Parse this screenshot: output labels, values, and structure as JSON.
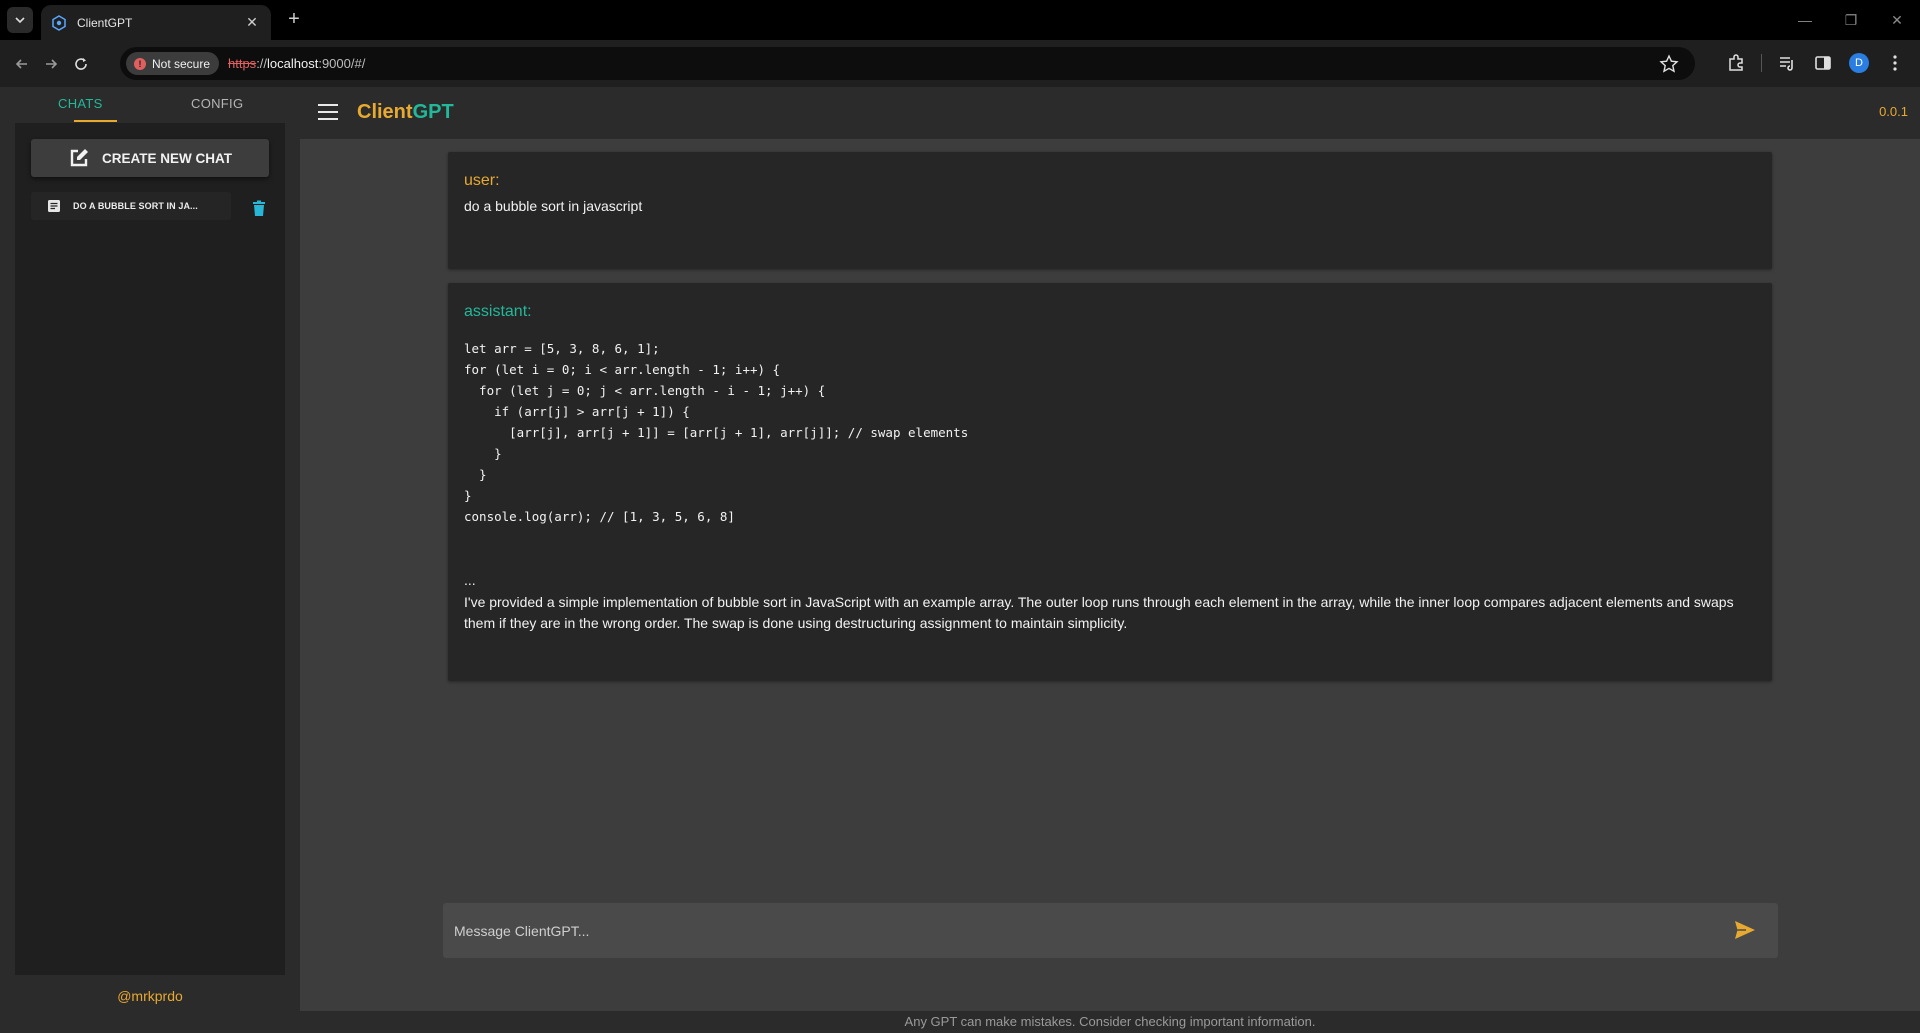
{
  "browser": {
    "tab_title": "ClientGPT",
    "security_label": "Not secure",
    "url_scheme": "https",
    "url_sep": "://",
    "url_host": "localhost",
    "url_rest": ":9000/#/",
    "profile_initial": "D"
  },
  "sidebar": {
    "tabs": [
      {
        "label": "CHATS",
        "active": true
      },
      {
        "label": "CONFIG",
        "active": false
      }
    ],
    "new_chat_label": "CREATE NEW CHAT",
    "chats": [
      {
        "label": "DO A BUBBLE SORT IN JA..."
      }
    ],
    "handle": "@mrkprdo"
  },
  "appbar": {
    "brand_part1": "Client",
    "brand_part2": "GPT",
    "version": "0.0.1"
  },
  "messages": {
    "user": {
      "role": "user:",
      "text": "do a bubble sort in javascript"
    },
    "assistant": {
      "role": "assistant:",
      "code": "let arr = [5, 3, 8, 6, 1];\nfor (let i = 0; i < arr.length - 1; i++) {\n  for (let j = 0; j < arr.length - i - 1; j++) {\n    if (arr[j] > arr[j + 1]) {\n      [arr[j], arr[j + 1]] = [arr[j + 1], arr[j]]; // swap elements\n    }\n  }\n}\nconsole.log(arr); // [1, 3, 5, 6, 8]",
      "ellipsis": "...",
      "explanation": "I've provided a simple implementation of bubble sort in JavaScript with an example array. The outer loop runs through each element in the array, while the inner loop compares adjacent elements and swaps them if they are in the wrong order. The swap is done using destructuring assignment to maintain simplicity."
    }
  },
  "composer": {
    "placeholder": "Message ClientGPT..."
  },
  "footer": {
    "disclaimer": "Any GPT can make mistakes. Consider checking important information."
  },
  "colors": {
    "accent_orange": "#e8a930",
    "accent_teal": "#22b89a",
    "trash_blue": "#29b6d6"
  }
}
